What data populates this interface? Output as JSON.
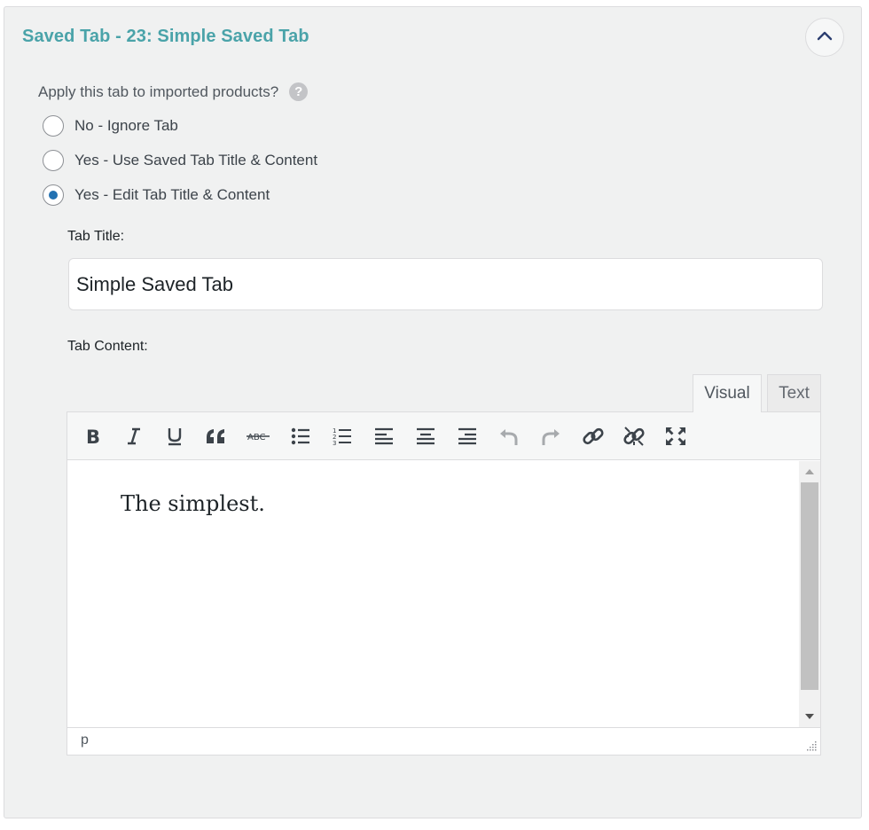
{
  "panel": {
    "title": "Saved Tab - 23: Simple Saved Tab",
    "collapse_icon": "chevron-up-icon"
  },
  "apply": {
    "question": "Apply this tab to imported products?",
    "help_icon": "?",
    "options": [
      {
        "label": "No - Ignore Tab",
        "selected": false
      },
      {
        "label": "Yes - Use Saved Tab Title & Content",
        "selected": false
      },
      {
        "label": "Yes - Edit Tab Title & Content",
        "selected": true
      }
    ]
  },
  "tab_title": {
    "label": "Tab Title:",
    "value": "Simple Saved Tab"
  },
  "tab_content": {
    "label": "Tab Content:",
    "tabs": {
      "visual": "Visual",
      "text": "Text"
    },
    "active_tab": "Visual",
    "toolbar": [
      "bold-icon",
      "italic-icon",
      "underline-icon",
      "blockquote-icon",
      "strikethrough-icon",
      "bulleted-list-icon",
      "numbered-list-icon",
      "align-left-icon",
      "align-center-icon",
      "align-right-icon",
      "undo-icon",
      "redo-icon",
      "insert-link-icon",
      "remove-link-icon",
      "fullscreen-icon"
    ],
    "body_text": "The simplest.",
    "status_path": "p"
  },
  "colors": {
    "title": "#4aa3a9",
    "radio_selected": "#2271b1",
    "panel_bg": "#f0f1f1"
  }
}
